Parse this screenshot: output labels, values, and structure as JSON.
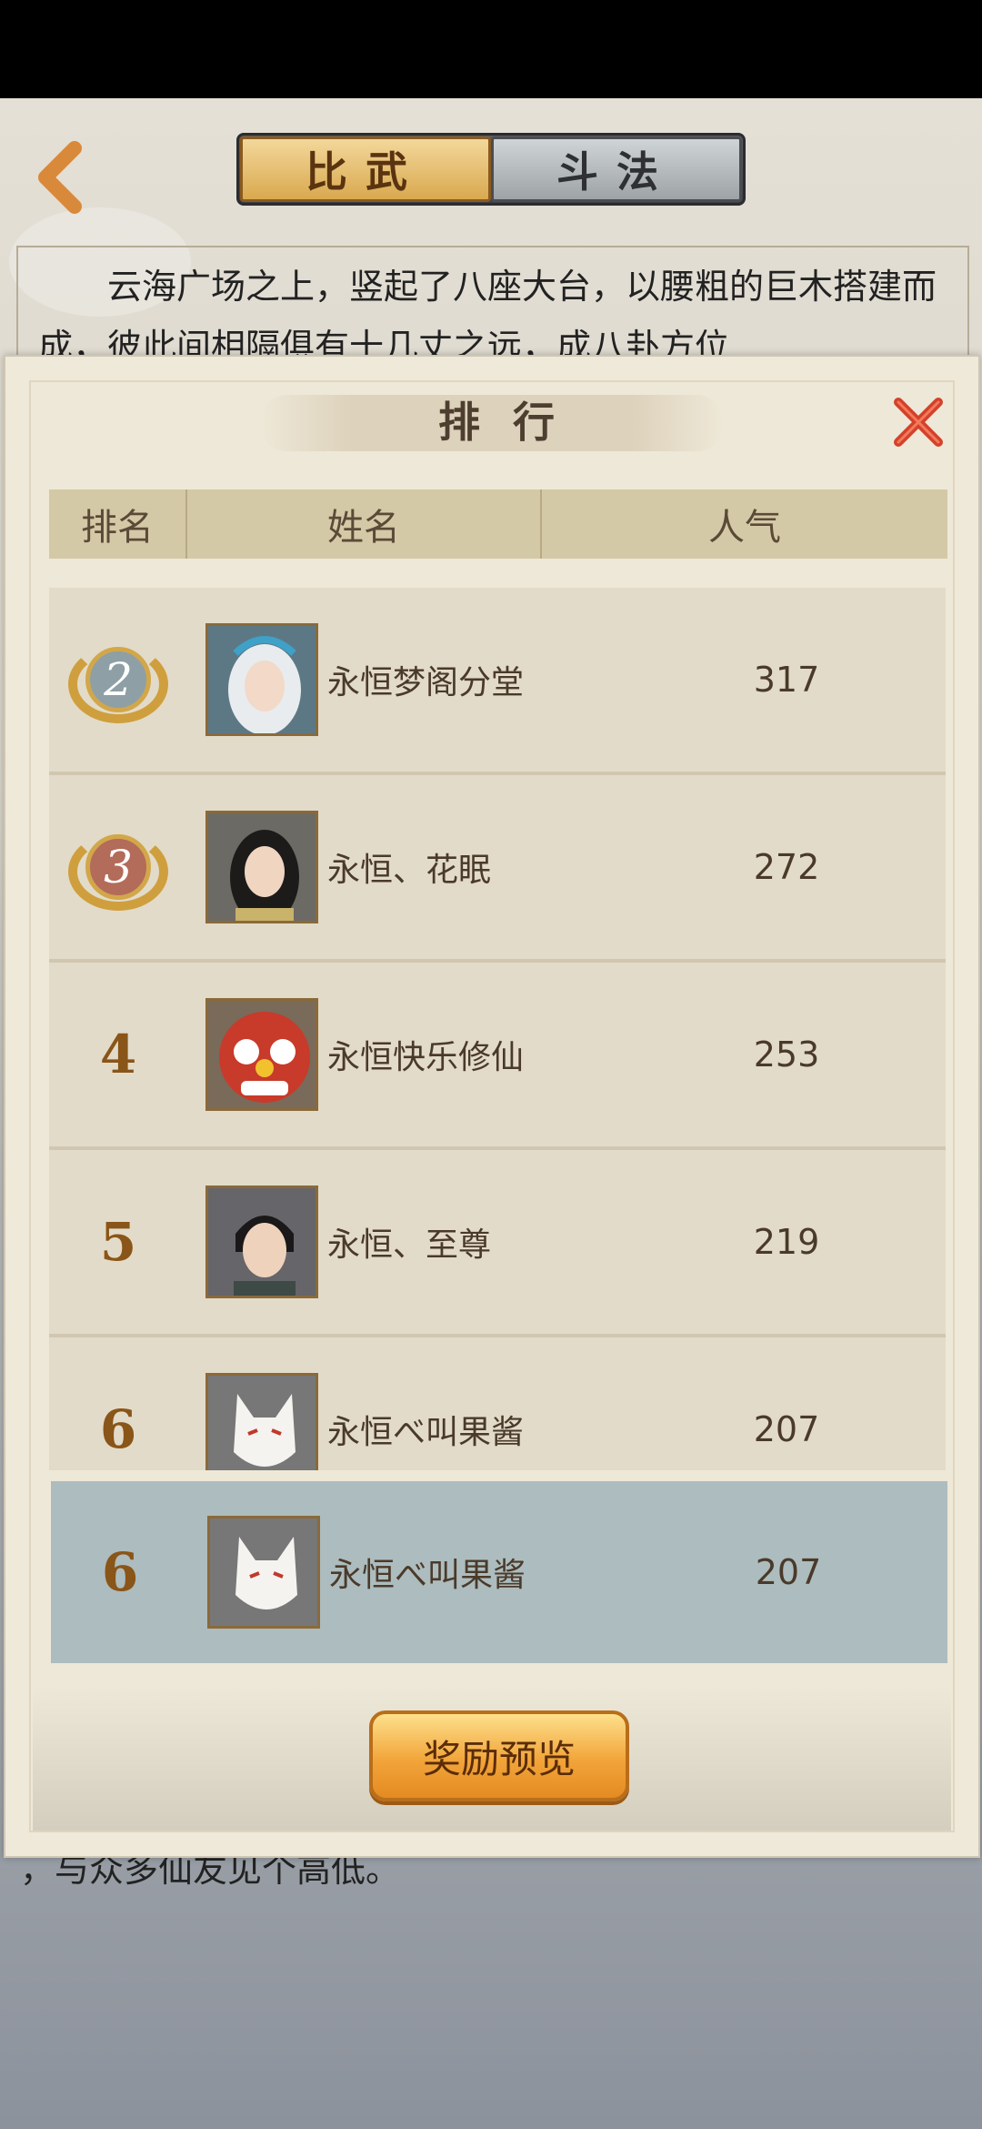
{
  "header": {
    "back_icon": "chevron-left-icon",
    "tabs": [
      {
        "label": "比武",
        "active": true
      },
      {
        "label": "斗法",
        "active": false
      }
    ]
  },
  "story": {
    "text": "云海广场之上，竖起了八座大台，以腰粗的巨木搭建而成，彼此间相隔俱有十几丈之远，成八卦方位",
    "tail": "，与众多仙友见个高低。"
  },
  "dialog": {
    "title": "排行",
    "close_icon": "close-icon",
    "columns": {
      "rank": "排名",
      "name": "姓名",
      "popularity": "人气"
    },
    "rows": [
      {
        "rank": "2",
        "medal": "silver",
        "name": "永恒梦阁分堂",
        "popularity": "317",
        "avatar": "white-hair-girl"
      },
      {
        "rank": "3",
        "medal": "bronze",
        "name": "永恒、花眠",
        "popularity": "272",
        "avatar": "black-hair-girl"
      },
      {
        "rank": "4",
        "medal": "",
        "name": "永恒快乐修仙",
        "popularity": "253",
        "avatar": "lion-mask"
      },
      {
        "rank": "5",
        "medal": "",
        "name": "永恒、至尊",
        "popularity": "219",
        "avatar": "young-man"
      },
      {
        "rank": "6",
        "medal": "",
        "name": "永恒べ叫果酱",
        "popularity": "207",
        "avatar": "fox-mask"
      }
    ],
    "my_rank": {
      "rank": "6",
      "name": "永恒べ叫果酱",
      "popularity": "207",
      "avatar": "fox-mask"
    },
    "reward_button": "奖励预览"
  },
  "colors": {
    "accent": "#8a5518",
    "highlight_row": "#adbcbe",
    "header_bg": "#d4c9a6"
  }
}
